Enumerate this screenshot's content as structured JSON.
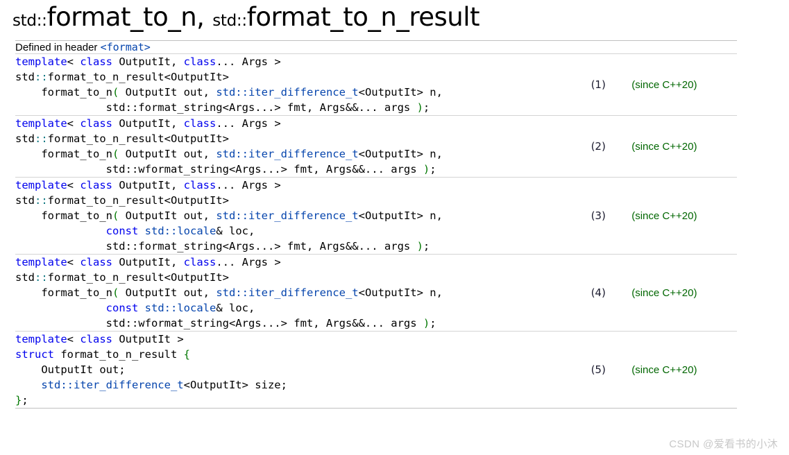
{
  "title": {
    "ns1": "std::",
    "name1": "format_to_n",
    "comma": ",",
    "ns2": "std::",
    "name2": "format_to_n_result"
  },
  "header_row": {
    "label": "Defined in header",
    "file": "<format>"
  },
  "colors": {
    "keyword": "#0000ee",
    "type_link": "#0645ad",
    "scope_operator": "#0d7680",
    "paren": "#007700",
    "since": "#006600",
    "number": "#1a1a2e",
    "border": "#d4d4d4",
    "watermark": "#c8c8c8"
  },
  "signatures": [
    {
      "number": "(1)",
      "since": "(since C++20)",
      "lines": [
        [
          {
            "t": "template",
            "c": "kw"
          },
          {
            "t": "< ",
            "c": "pl"
          },
          {
            "t": "class",
            "c": "kw"
          },
          {
            "t": " OutputIt, ",
            "c": "pl"
          },
          {
            "t": "class",
            "c": "kw"
          },
          {
            "t": "... Args >",
            "c": "pl"
          }
        ],
        [
          {
            "t": "std",
            "c": "pl"
          },
          {
            "t": "::",
            "c": "sep"
          },
          {
            "t": "format_to_n_result<OutputIt>",
            "c": "pl"
          }
        ],
        [
          {
            "t": "    format_to_n",
            "c": "pl"
          },
          {
            "t": "(",
            "c": "pn"
          },
          {
            "t": " OutputIt out, ",
            "c": "pl"
          },
          {
            "t": "std::iter_difference_t",
            "c": "ty"
          },
          {
            "t": "<OutputIt> n,",
            "c": "pl"
          }
        ],
        [
          {
            "t": "              std::format_string<Args...> fmt, Args&&... args ",
            "c": "pl"
          },
          {
            "t": ")",
            "c": "pn"
          },
          {
            "t": ";",
            "c": "pl"
          }
        ]
      ]
    },
    {
      "number": "(2)",
      "since": "(since C++20)",
      "lines": [
        [
          {
            "t": "template",
            "c": "kw"
          },
          {
            "t": "< ",
            "c": "pl"
          },
          {
            "t": "class",
            "c": "kw"
          },
          {
            "t": " OutputIt, ",
            "c": "pl"
          },
          {
            "t": "class",
            "c": "kw"
          },
          {
            "t": "... Args >",
            "c": "pl"
          }
        ],
        [
          {
            "t": "std",
            "c": "pl"
          },
          {
            "t": "::",
            "c": "sep"
          },
          {
            "t": "format_to_n_result<OutputIt>",
            "c": "pl"
          }
        ],
        [
          {
            "t": "    format_to_n",
            "c": "pl"
          },
          {
            "t": "(",
            "c": "pn"
          },
          {
            "t": " OutputIt out, ",
            "c": "pl"
          },
          {
            "t": "std::iter_difference_t",
            "c": "ty"
          },
          {
            "t": "<OutputIt> n,",
            "c": "pl"
          }
        ],
        [
          {
            "t": "              std::wformat_string<Args...> fmt, Args&&... args ",
            "c": "pl"
          },
          {
            "t": ")",
            "c": "pn"
          },
          {
            "t": ";",
            "c": "pl"
          }
        ]
      ]
    },
    {
      "number": "(3)",
      "since": "(since C++20)",
      "lines": [
        [
          {
            "t": "template",
            "c": "kw"
          },
          {
            "t": "< ",
            "c": "pl"
          },
          {
            "t": "class",
            "c": "kw"
          },
          {
            "t": " OutputIt, ",
            "c": "pl"
          },
          {
            "t": "class",
            "c": "kw"
          },
          {
            "t": "... Args >",
            "c": "pl"
          }
        ],
        [
          {
            "t": "std",
            "c": "pl"
          },
          {
            "t": "::",
            "c": "sep"
          },
          {
            "t": "format_to_n_result<OutputIt>",
            "c": "pl"
          }
        ],
        [
          {
            "t": "    format_to_n",
            "c": "pl"
          },
          {
            "t": "(",
            "c": "pn"
          },
          {
            "t": " OutputIt out, ",
            "c": "pl"
          },
          {
            "t": "std::iter_difference_t",
            "c": "ty"
          },
          {
            "t": "<OutputIt> n,",
            "c": "pl"
          }
        ],
        [
          {
            "t": "              ",
            "c": "pl"
          },
          {
            "t": "const",
            "c": "kw"
          },
          {
            "t": " ",
            "c": "pl"
          },
          {
            "t": "std::locale",
            "c": "ty"
          },
          {
            "t": "& loc,",
            "c": "pl"
          }
        ],
        [
          {
            "t": "              std::format_string<Args...> fmt, Args&&... args ",
            "c": "pl"
          },
          {
            "t": ")",
            "c": "pn"
          },
          {
            "t": ";",
            "c": "pl"
          }
        ]
      ]
    },
    {
      "number": "(4)",
      "since": "(since C++20)",
      "lines": [
        [
          {
            "t": "template",
            "c": "kw"
          },
          {
            "t": "< ",
            "c": "pl"
          },
          {
            "t": "class",
            "c": "kw"
          },
          {
            "t": " OutputIt, ",
            "c": "pl"
          },
          {
            "t": "class",
            "c": "kw"
          },
          {
            "t": "... Args >",
            "c": "pl"
          }
        ],
        [
          {
            "t": "std",
            "c": "pl"
          },
          {
            "t": "::",
            "c": "sep"
          },
          {
            "t": "format_to_n_result<OutputIt>",
            "c": "pl"
          }
        ],
        [
          {
            "t": "    format_to_n",
            "c": "pl"
          },
          {
            "t": "(",
            "c": "pn"
          },
          {
            "t": " OutputIt out, ",
            "c": "pl"
          },
          {
            "t": "std::iter_difference_t",
            "c": "ty"
          },
          {
            "t": "<OutputIt> n,",
            "c": "pl"
          }
        ],
        [
          {
            "t": "              ",
            "c": "pl"
          },
          {
            "t": "const",
            "c": "kw"
          },
          {
            "t": " ",
            "c": "pl"
          },
          {
            "t": "std::locale",
            "c": "ty"
          },
          {
            "t": "& loc,",
            "c": "pl"
          }
        ],
        [
          {
            "t": "              std::wformat_string<Args...> fmt, Args&&... args ",
            "c": "pl"
          },
          {
            "t": ")",
            "c": "pn"
          },
          {
            "t": ";",
            "c": "pl"
          }
        ]
      ]
    },
    {
      "number": "(5)",
      "since": "(since C++20)",
      "lines": [
        [
          {
            "t": "template",
            "c": "kw"
          },
          {
            "t": "< ",
            "c": "pl"
          },
          {
            "t": "class",
            "c": "kw"
          },
          {
            "t": " OutputIt >",
            "c": "pl"
          }
        ],
        [
          {
            "t": "struct",
            "c": "kw"
          },
          {
            "t": " format_to_n_result ",
            "c": "pl"
          },
          {
            "t": "{",
            "c": "pn"
          }
        ],
        [
          {
            "t": "    OutputIt out;",
            "c": "pl"
          }
        ],
        [
          {
            "t": "    ",
            "c": "pl"
          },
          {
            "t": "std::iter_difference_t",
            "c": "ty"
          },
          {
            "t": "<OutputIt> size;",
            "c": "pl"
          }
        ],
        [
          {
            "t": "}",
            "c": "pn"
          },
          {
            "t": ";",
            "c": "pl"
          }
        ]
      ]
    }
  ],
  "watermark": "CSDN @爱看书的小沐"
}
